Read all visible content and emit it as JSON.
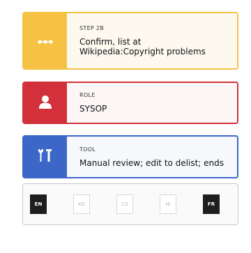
{
  "step": {
    "label": "STEP 2B",
    "text_line1": "Confirm, list at",
    "text_line2": "Wikipedia:Copyright problems",
    "icon": "dots-icon",
    "color": "#f6c244"
  },
  "role": {
    "label": "ROLE",
    "text": "SYSOP",
    "icon": "user-icon",
    "color": "#d2303a"
  },
  "tool": {
    "label": "TOOL",
    "text": "Manual review; edit to delist; ends",
    "icon": "tools-icon",
    "color": "#3c67c9"
  },
  "languages": [
    {
      "code": "EN",
      "active": true
    },
    {
      "code": "KO",
      "active": false
    },
    {
      "code": "CS",
      "active": false
    },
    {
      "code": "HI",
      "active": false
    },
    {
      "code": "FR",
      "active": true
    }
  ]
}
